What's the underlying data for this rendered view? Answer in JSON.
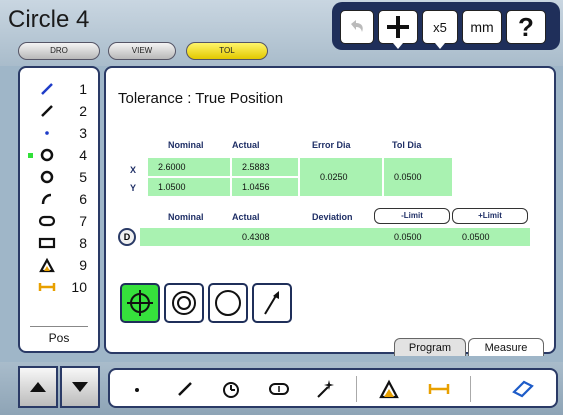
{
  "title": "Circle 4",
  "mode_buttons": [
    "DRO",
    "VIEW",
    "TOL"
  ],
  "toolbar": {
    "units": "mm",
    "zoom": "x5",
    "help": "?"
  },
  "features": [
    {
      "num": "1",
      "icon": "line-icon"
    },
    {
      "num": "2",
      "icon": "line-icon"
    },
    {
      "num": "3",
      "icon": "point-icon"
    },
    {
      "num": "4",
      "icon": "circle-icon",
      "selected": true
    },
    {
      "num": "5",
      "icon": "circle-icon"
    },
    {
      "num": "6",
      "icon": "arc-icon"
    },
    {
      "num": "7",
      "icon": "slot-icon"
    },
    {
      "num": "8",
      "icon": "rectangle-icon"
    },
    {
      "num": "9",
      "icon": "angle-icon"
    },
    {
      "num": "10",
      "icon": "distance-icon"
    }
  ],
  "left_tab": "Pos",
  "panel": {
    "title": "Tolerance : True Position",
    "headers1": [
      "Nominal",
      "Actual",
      "Error Dia",
      "Tol Dia"
    ],
    "axes": [
      "X",
      "Y"
    ],
    "x_nominal": "2.6000",
    "x_actual": "2.5883",
    "y_nominal": "1.0500",
    "y_actual": "1.0456",
    "error_dia": "0.0250",
    "tol_dia": "0.0500",
    "headers2": [
      "Nominal",
      "Actual",
      "Deviation"
    ],
    "limit_minus": "-Limit",
    "limit_plus": "+Limit",
    "d_label": "D",
    "d_actual": "0.4308",
    "d_minus": "0.0500",
    "d_plus": "0.0500"
  },
  "tabs": [
    "Program",
    "Measure"
  ],
  "colors": {
    "accent_green": "#36e03c",
    "cell_green": "#a9f2b1",
    "active_tol": "#e8d000",
    "frame": "#2a3a66"
  }
}
